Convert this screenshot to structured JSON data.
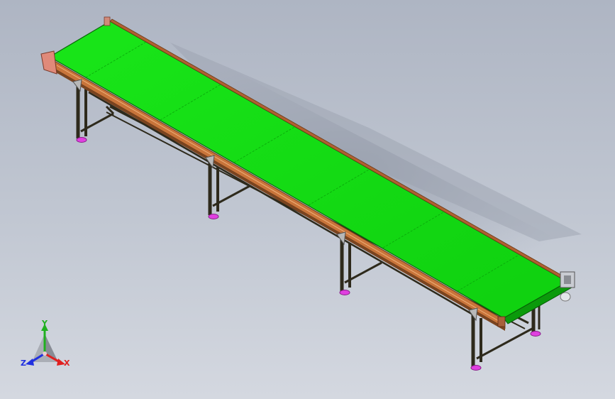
{
  "viewport": {
    "background_top": "#aeb5c3",
    "background_bottom": "#d4d8e0"
  },
  "model": {
    "name": "",
    "belt_color": "#11dd11",
    "belt_edge_color": "#0a9a0a",
    "side_rail_color": "#c8743a",
    "frame_color": "#2e2a1c",
    "foot_color": "#e040e0"
  },
  "triad": {
    "x_label": "X",
    "y_label": "Y",
    "z_label": "Z",
    "x_color": "#e02020",
    "y_color": "#20b020",
    "z_color": "#2030e0"
  }
}
